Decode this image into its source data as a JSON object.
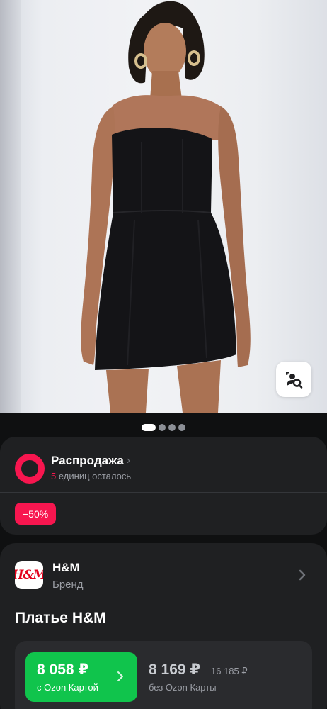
{
  "gallery": {
    "image_alt": "Model in black strapless mini dress",
    "dots": [
      true,
      false,
      false,
      false
    ],
    "search_icon": "image-search-icon"
  },
  "sale": {
    "title": "Распродажа",
    "chevron": "›",
    "units_count": "5",
    "units_text": " единиц осталось",
    "discount": "−50%",
    "accent_color": "#f7164f"
  },
  "brand": {
    "logo_text": "H&M",
    "name": "H&M",
    "subtitle": "Бренд"
  },
  "product": {
    "title": "Платье H&M"
  },
  "price": {
    "ozon_amount": "8 058 ₽",
    "ozon_label": "с Ozon Картой",
    "regular_amount": "8 169 ₽",
    "old_amount": "16 185 ₽",
    "regular_label": "без Ozon Карты",
    "ozon_color": "#10c44c"
  }
}
